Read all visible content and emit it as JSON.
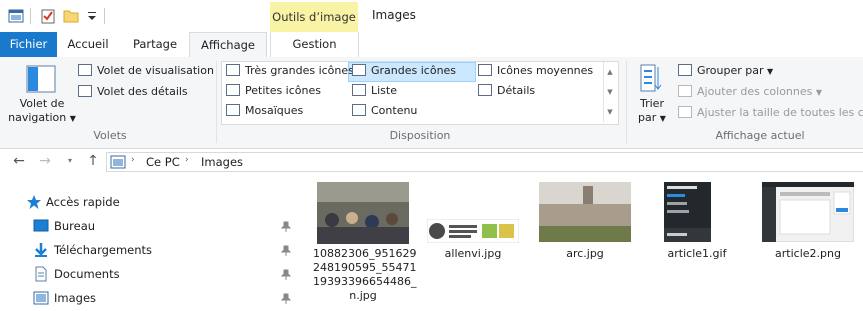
{
  "titlebar": {
    "context_tab": "Outils d’image",
    "window_title": "Images"
  },
  "ribbon_tabs": {
    "file": "Fichier",
    "home": "Accueil",
    "share": "Partage",
    "view": "Affichage",
    "manage": "Gestion"
  },
  "panes_group": {
    "nav_pane_label_1": "Volet de",
    "nav_pane_label_2": "navigation",
    "preview_pane": "Volet de visualisation",
    "details_pane": "Volet des détails",
    "group_label": "Volets"
  },
  "layout_group": {
    "extra_large": "Très grandes icônes",
    "large": "Grandes icônes",
    "medium": "Icônes moyennes",
    "small": "Petites icônes",
    "list": "Liste",
    "details": "Détails",
    "tiles": "Mosaïques",
    "content": "Contenu",
    "group_label": "Disposition"
  },
  "current_view_group": {
    "sort_label_1": "Trier",
    "sort_label_2": "par",
    "group_by": "Grouper par",
    "add_columns": "Ajouter des colonnes",
    "size_columns": "Ajuster la taille de toutes les colo",
    "group_label": "Affichage actuel"
  },
  "address": {
    "crumbs": [
      "Ce PC",
      "Images"
    ]
  },
  "nav_pane": {
    "quick_access": "Accès rapide",
    "items": [
      "Bureau",
      "Téléchargements",
      "Documents",
      "Images"
    ]
  },
  "files": [
    {
      "name_lines": [
        "10882306_951629",
        "248190595_55471",
        "19393396654486_",
        "n.jpg"
      ]
    },
    {
      "name_lines": [
        "allenvi.jpg"
      ]
    },
    {
      "name_lines": [
        "arc.jpg"
      ]
    },
    {
      "name_lines": [
        "article1.gif"
      ]
    },
    {
      "name_lines": [
        "article2.png"
      ]
    }
  ],
  "colors": {
    "file_tab": "#1979ca",
    "context_tab": "#f9f3a6",
    "selection": "#cce8ff",
    "accent_icon": "#1c7fd6"
  }
}
